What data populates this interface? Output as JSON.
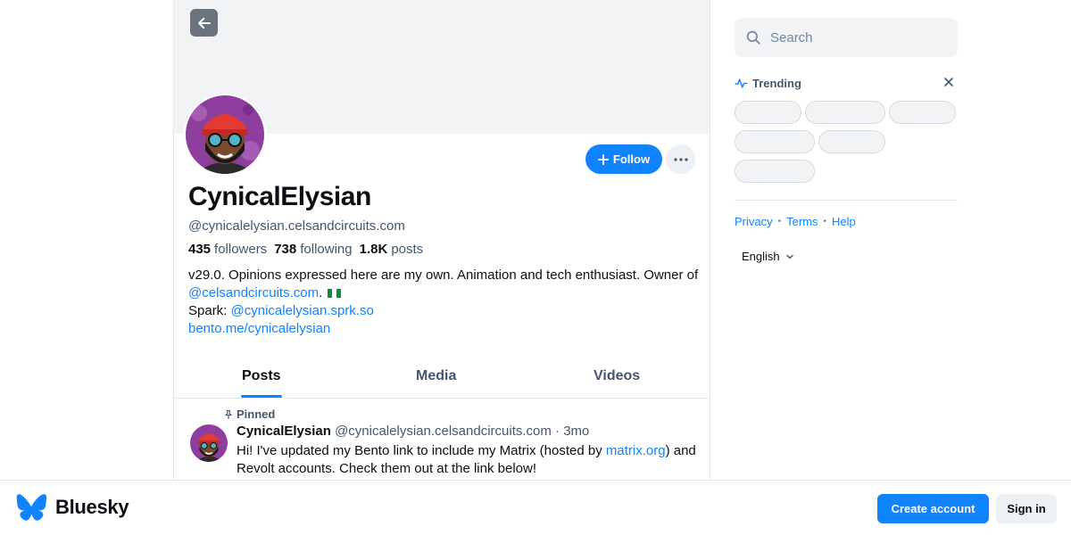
{
  "profile": {
    "display_name": "CynicalElysian",
    "handle": "@cynicalelysian.celsandcircuits.com",
    "followers_count": "435",
    "followers_label": "followers",
    "following_count": "738",
    "following_label": "following",
    "posts_count": "1.8K",
    "posts_label": "posts",
    "bio_line1": "v29.0. Opinions expressed here are my own. Animation and tech enthusiast. Owner of",
    "bio_link1": "@celsandcircuits.com",
    "bio_after_link1": ".",
    "bio_spark_label": "Spark:",
    "bio_spark_link": "@cynicalelysian.sprk.so",
    "bio_bento_link": "bento.me/cynicalelysian",
    "follow_label": "Follow"
  },
  "tabs": [
    {
      "label": "Posts",
      "active": true
    },
    {
      "label": "Media",
      "active": false
    },
    {
      "label": "Videos",
      "active": false
    }
  ],
  "post": {
    "pinned_label": "Pinned",
    "author": "CynicalElysian",
    "handle": "@cynicalelysian.celsandcircuits.com",
    "separator": "·",
    "time": "3mo",
    "text_before_link": "Hi! I've updated my Bento link to include my Matrix (hosted by",
    "text_link": "matrix.org",
    "text_after_link": ") and Revolt accounts. Check them out at the link below!"
  },
  "sidebar": {
    "search_placeholder": "Search",
    "trending_label": "Trending",
    "footer_links": [
      "Privacy",
      "Terms",
      "Help"
    ],
    "language": "English"
  },
  "bottom_bar": {
    "brand": "Bluesky",
    "create_account": "Create account",
    "sign_in": "Sign in"
  },
  "colors": {
    "accent": "#1083fe",
    "banner": "#f1f3f5",
    "muted_text": "#42576c"
  }
}
